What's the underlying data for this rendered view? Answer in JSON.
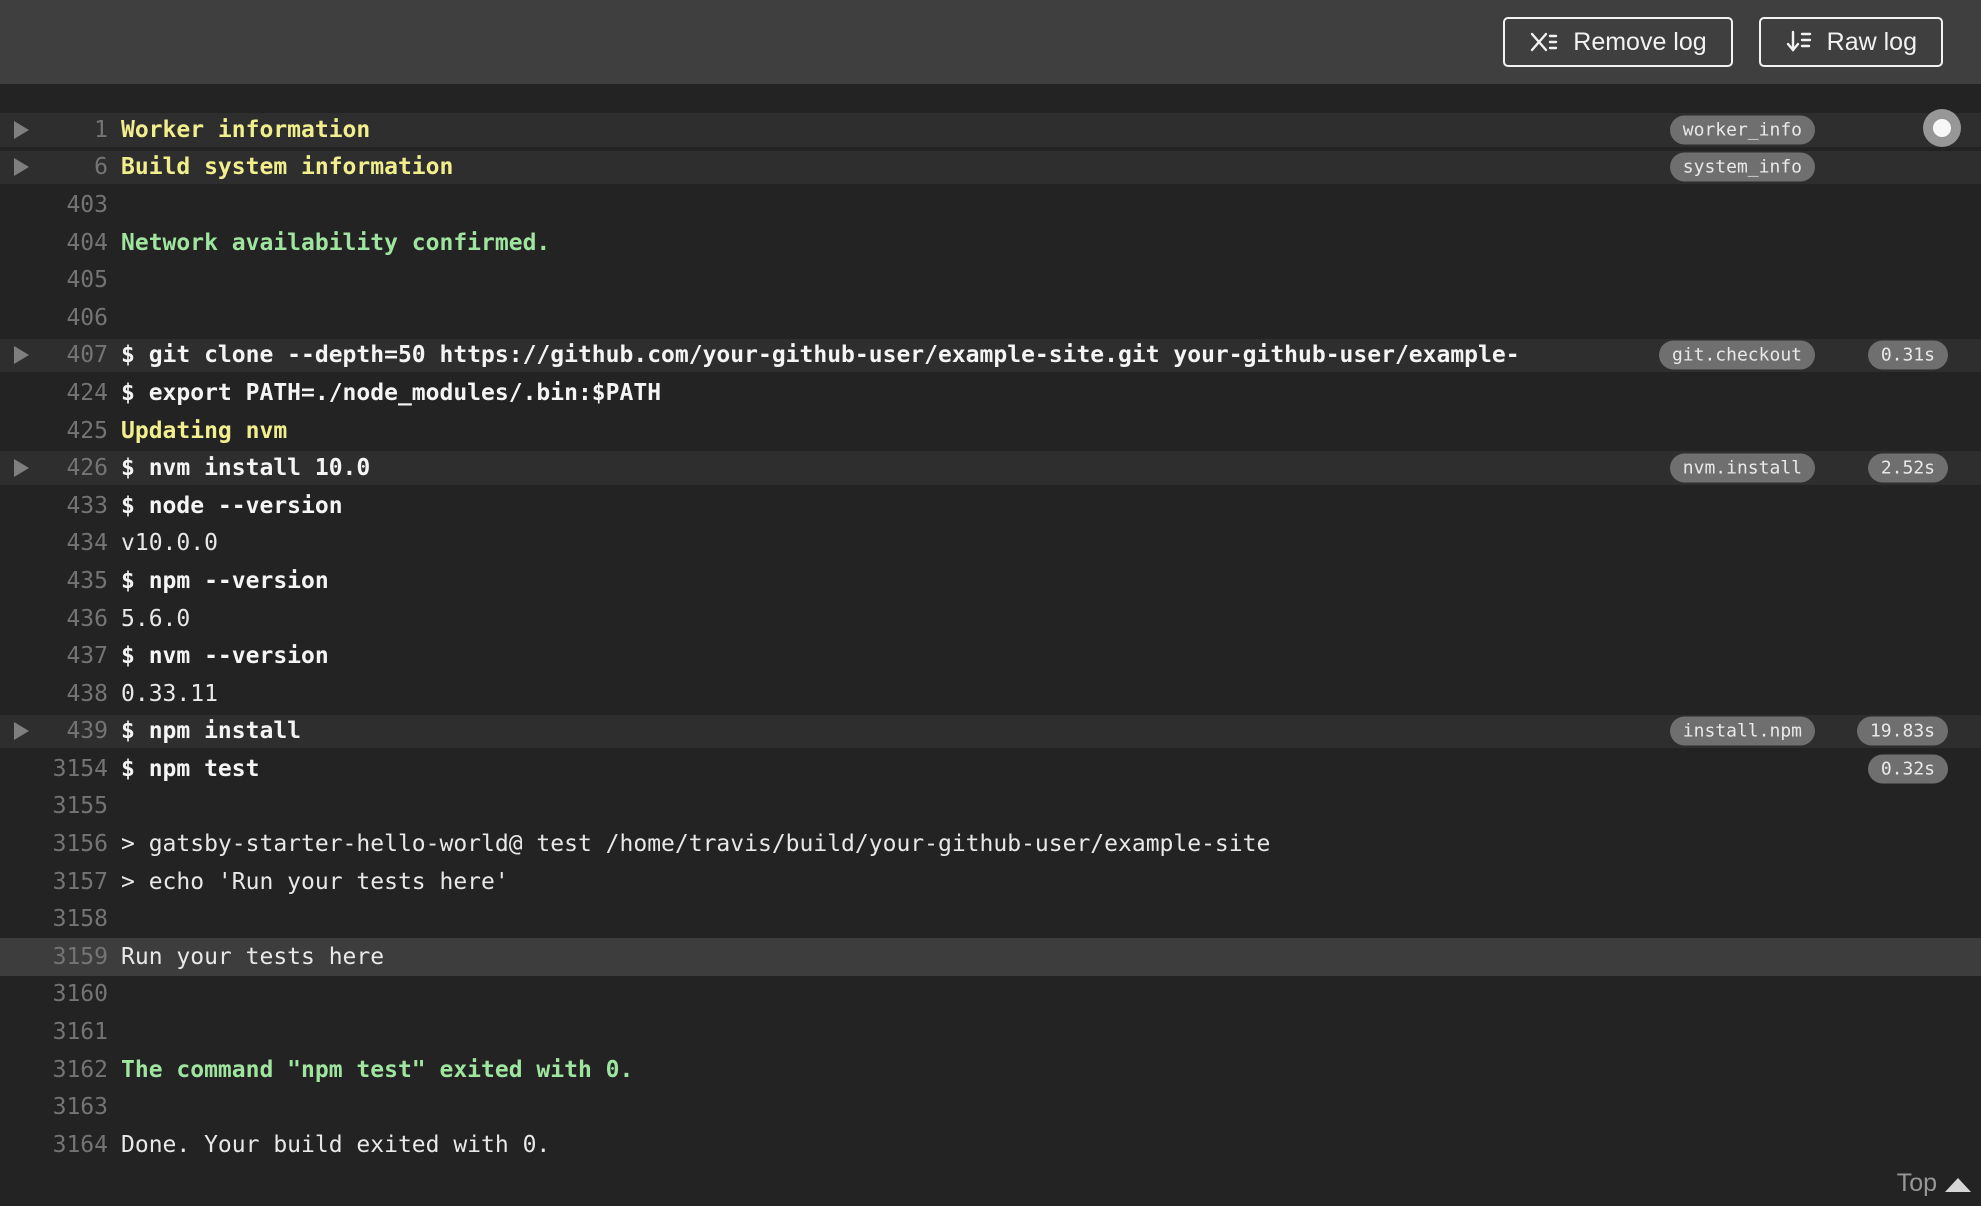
{
  "toolbar": {
    "remove_log_label": "Remove log",
    "raw_log_label": "Raw log",
    "remove_log_icon": "x-list-icon",
    "raw_log_icon": "download-list-icon"
  },
  "footer": {
    "top_label": "Top"
  },
  "colors": {
    "background": "#232323",
    "header": "#3f3f3f",
    "section_yellow": "#f1ee8d",
    "success_green": "#9fe59f",
    "command_white": "#f4f4f4",
    "line_number_gray": "#747474",
    "badge_gray": "#6f6f6f",
    "fold_row": "#2e2e2e",
    "selected_row": "#3d3d3d"
  },
  "log": {
    "lines": [
      {
        "num": "1",
        "text": "Worker information",
        "style": "section",
        "fold": true,
        "highlight": true,
        "tag": "worker_info"
      },
      {
        "num": "6",
        "text": "Build system information",
        "style": "section",
        "fold": true,
        "highlight": true,
        "tag": "system_info"
      },
      {
        "num": "403",
        "text": "",
        "style": "plain"
      },
      {
        "num": "404",
        "text": "Network availability confirmed.",
        "style": "success"
      },
      {
        "num": "405",
        "text": "",
        "style": "plain"
      },
      {
        "num": "406",
        "text": "",
        "style": "plain"
      },
      {
        "num": "407",
        "text": "$ git clone --depth=50 https://github.com/your-github-user/example-site.git your-github-user/example-",
        "style": "command",
        "fold": true,
        "highlight": true,
        "tag": "git.checkout",
        "time": "0.31s"
      },
      {
        "num": "424",
        "text": "$ export PATH=./node_modules/.bin:$PATH",
        "style": "command"
      },
      {
        "num": "425",
        "text": "Updating nvm",
        "style": "section"
      },
      {
        "num": "426",
        "text": "$ nvm install 10.0",
        "style": "command",
        "fold": true,
        "highlight": true,
        "tag": "nvm.install",
        "time": "2.52s"
      },
      {
        "num": "433",
        "text": "$ node --version",
        "style": "command"
      },
      {
        "num": "434",
        "text": "v10.0.0",
        "style": "output"
      },
      {
        "num": "435",
        "text": "$ npm --version",
        "style": "command"
      },
      {
        "num": "436",
        "text": "5.6.0",
        "style": "output"
      },
      {
        "num": "437",
        "text": "$ nvm --version",
        "style": "command"
      },
      {
        "num": "438",
        "text": "0.33.11",
        "style": "output"
      },
      {
        "num": "439",
        "text": "$ npm install",
        "style": "command",
        "fold": true,
        "highlight": true,
        "tag": "install.npm",
        "time": "19.83s"
      },
      {
        "num": "3154",
        "text": "$ npm test",
        "style": "command",
        "time": "0.32s"
      },
      {
        "num": "3155",
        "text": "",
        "style": "plain"
      },
      {
        "num": "3156",
        "text": "> gatsby-starter-hello-world@ test /home/travis/build/your-github-user/example-site",
        "style": "output"
      },
      {
        "num": "3157",
        "text": "> echo 'Run your tests here'",
        "style": "output"
      },
      {
        "num": "3158",
        "text": "",
        "style": "plain"
      },
      {
        "num": "3159",
        "text": "Run your tests here",
        "style": "output",
        "selected": true
      },
      {
        "num": "3160",
        "text": "",
        "style": "plain"
      },
      {
        "num": "3161",
        "text": "",
        "style": "plain"
      },
      {
        "num": "3162",
        "text": "The command \"npm test\" exited with 0.",
        "style": "success"
      },
      {
        "num": "3163",
        "text": "",
        "style": "plain"
      },
      {
        "num": "3164",
        "text": "Done. Your build exited with 0.",
        "style": "output"
      }
    ]
  }
}
